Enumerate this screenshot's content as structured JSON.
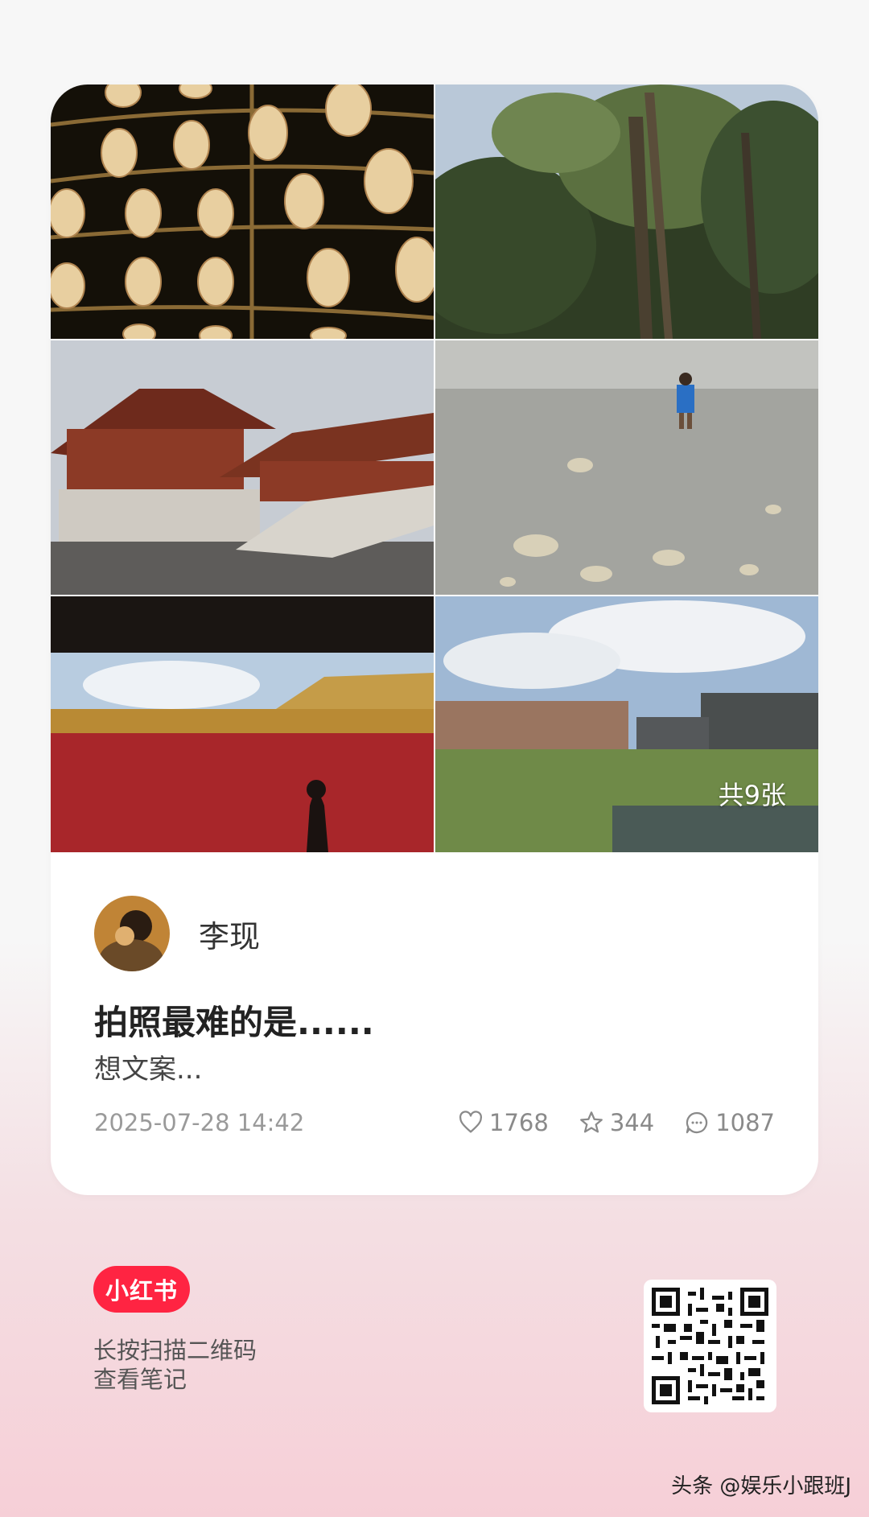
{
  "post": {
    "image_count_label": "共9张",
    "author_name": "李现",
    "title": "拍照最难的是......",
    "description": "想文案...",
    "date": "2025-07-28 14:42",
    "likes": "1768",
    "favorites": "344",
    "comments": "1087"
  },
  "footer": {
    "brand": "小红书",
    "hint_line1": "长按扫描二维码",
    "hint_line2": "查看笔记",
    "watermark": "头条 @娱乐小跟班J"
  },
  "colors": {
    "brand_red": "#ff2442",
    "text_primary": "#222222",
    "text_meta": "#9a9a9a"
  },
  "icons": [
    "heart-icon",
    "star-icon",
    "comment-icon",
    "qr-code-icon"
  ]
}
